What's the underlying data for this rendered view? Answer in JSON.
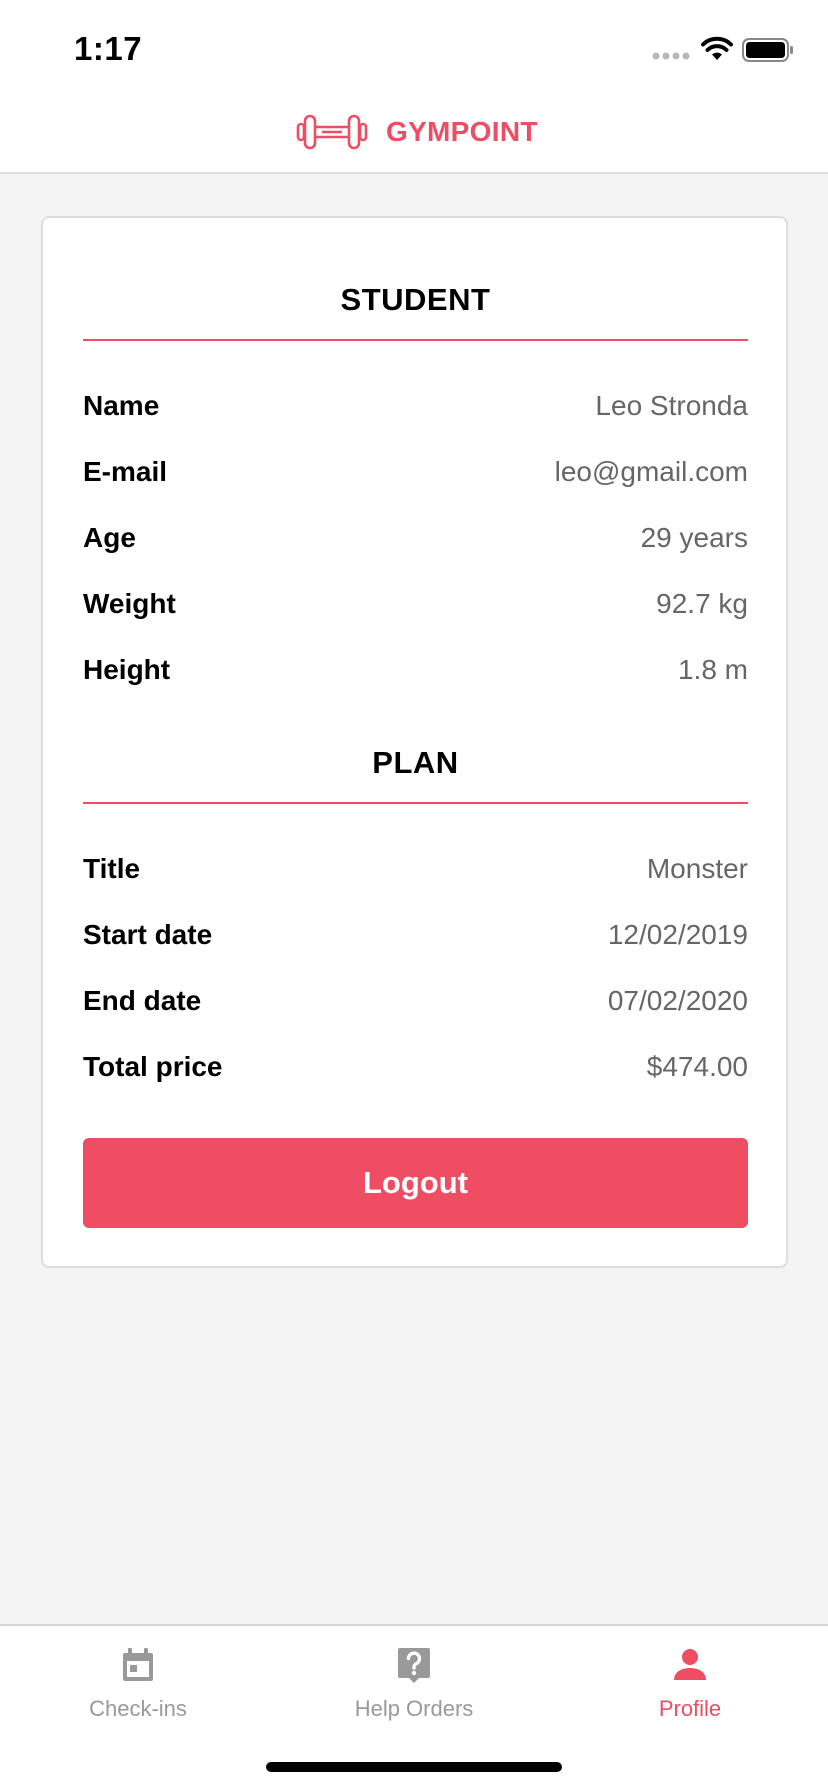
{
  "status_bar": {
    "time": "1:17"
  },
  "header": {
    "app_name": "GYMPOINT",
    "logo_icon": "dumbbell-icon",
    "brand_color": "#ee4d64"
  },
  "student": {
    "title": "STUDENT",
    "rows": [
      {
        "label": "Name",
        "value": "Leo Stronda"
      },
      {
        "label": "E-mail",
        "value": "leo@gmail.com"
      },
      {
        "label": "Age",
        "value": "29 years"
      },
      {
        "label": "Weight",
        "value": "92.7 kg"
      },
      {
        "label": "Height",
        "value": "1.8 m"
      }
    ]
  },
  "plan": {
    "title": "PLAN",
    "rows": [
      {
        "label": "Title",
        "value": "Monster"
      },
      {
        "label": "Start date",
        "value": "12/02/2019"
      },
      {
        "label": "End date",
        "value": "07/02/2020"
      },
      {
        "label": "Total price",
        "value": "$474.00"
      }
    ]
  },
  "logout_label": "Logout",
  "tabs": [
    {
      "label": "Check-ins",
      "icon": "calendar-icon",
      "active": false
    },
    {
      "label": "Help Orders",
      "icon": "help-question-icon",
      "active": false
    },
    {
      "label": "Profile",
      "icon": "person-icon",
      "active": true
    }
  ],
  "colors": {
    "accent": "#ee4d64",
    "inactive_tab": "#999999",
    "value_text": "#666666"
  }
}
